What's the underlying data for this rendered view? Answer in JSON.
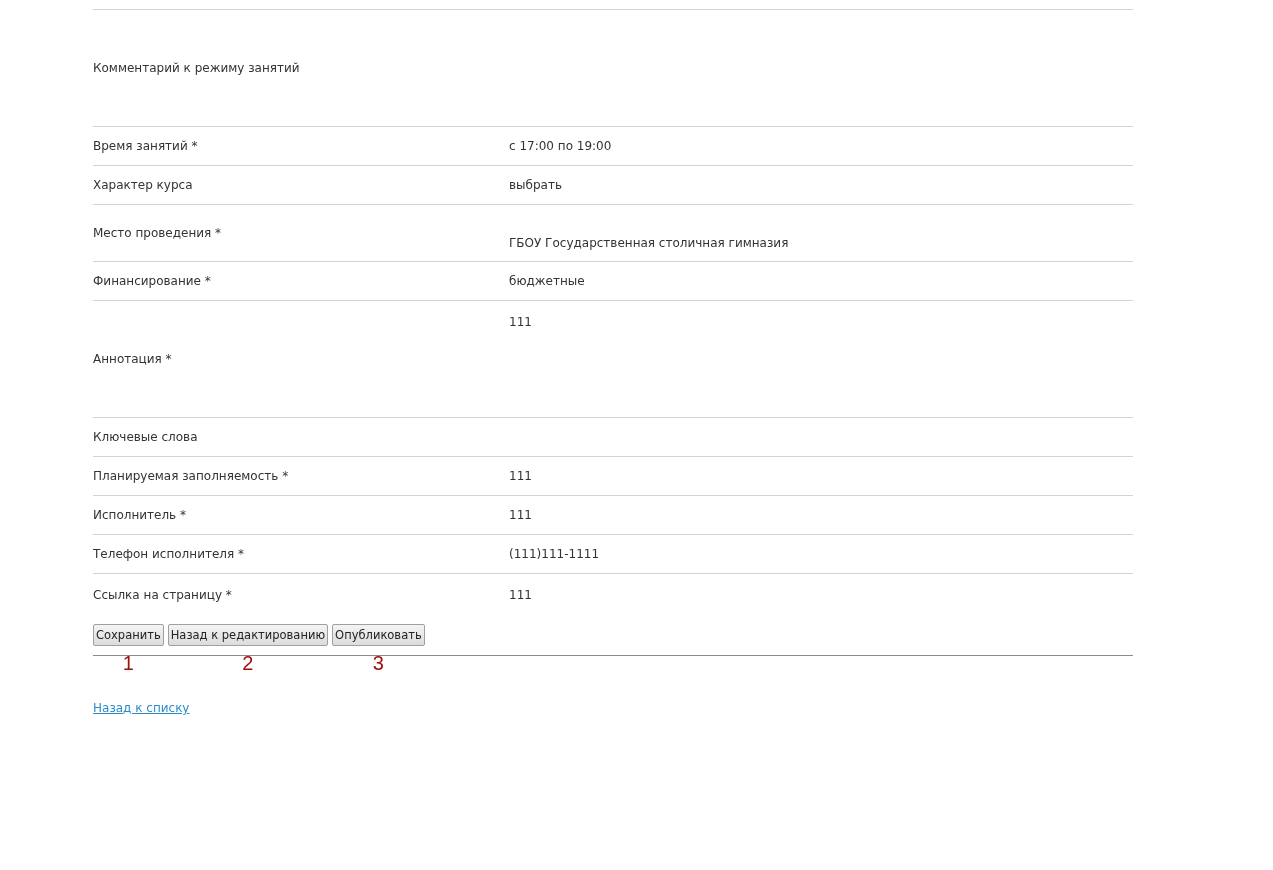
{
  "fields": [
    {
      "kind": "comment",
      "label": "Комментарий к режиму занятий"
    },
    {
      "kind": "normal",
      "label": "Время занятий *",
      "value": "с 17:00 по 19:00"
    },
    {
      "kind": "normal",
      "label": "Характер курса",
      "value": "выбрать"
    },
    {
      "kind": "split",
      "label": "Место проведения *",
      "value": "ГБОУ Государственная столичная гимназия"
    },
    {
      "kind": "normal",
      "label": "Финансирование *",
      "value": "бюджетные"
    },
    {
      "kind": "annotation",
      "label": "Аннотация *",
      "value": "111"
    },
    {
      "kind": "normal",
      "label": "Ключевые слова"
    },
    {
      "kind": "normal",
      "label": "Планируемая заполняемость *",
      "value": "111"
    },
    {
      "kind": "normal",
      "label": "Исполнитель *",
      "value": "111"
    },
    {
      "kind": "normal",
      "label": "Телефон исполнителя *",
      "value": "(111)111-1111"
    },
    {
      "kind": "last",
      "label": "Ссылка на страницу *",
      "value": "111"
    }
  ],
  "buttons": [
    {
      "label": "Сохранить",
      "marker": "1"
    },
    {
      "label": "Назад к редактированию",
      "marker": "2"
    },
    {
      "label": "Опубликовать",
      "marker": "3"
    }
  ],
  "back_link": "Назад к списку"
}
